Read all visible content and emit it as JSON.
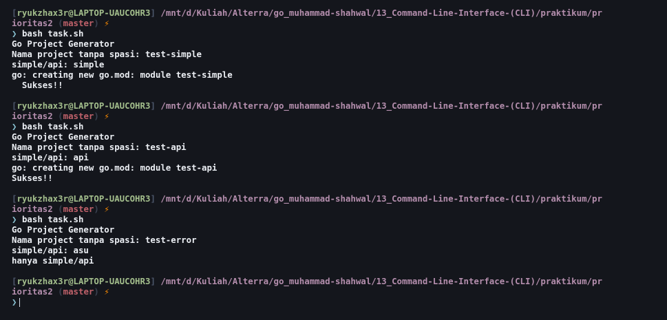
{
  "prompt": {
    "bracket_open": "[",
    "bracket_close": "]",
    "user_host": "ryukzhax3r@LAPTOP-UAUCOHR3",
    "path_line1": "/mnt/d/Kuliah/Alterra/go_muhammad-shahwal/13_Command-Line-Interface-(CLI)/praktikum/pr",
    "path_line2": "ioritas2",
    "branch_open": "(",
    "branch": "master",
    "branch_close": ")",
    "bolt": "⚡",
    "chevron": "❯"
  },
  "sessions": [
    {
      "command": "bash task.sh",
      "output": [
        "Go Project Generator",
        "Nama project tanpa spasi: test-simple",
        "simple/api: simple",
        "go: creating new go.mod: module test-simple",
        "  Sukses!!"
      ]
    },
    {
      "command": "bash task.sh",
      "output": [
        "Go Project Generator",
        "Nama project tanpa spasi: test-api",
        "simple/api: api",
        "go: creating new go.mod: module test-api",
        "Sukses!!"
      ]
    },
    {
      "command": "bash task.sh",
      "output": [
        "Go Project Generator",
        "Nama project tanpa spasi: test-error",
        "simple/api: asu",
        "hanya simple/api"
      ]
    }
  ],
  "current_input": ""
}
